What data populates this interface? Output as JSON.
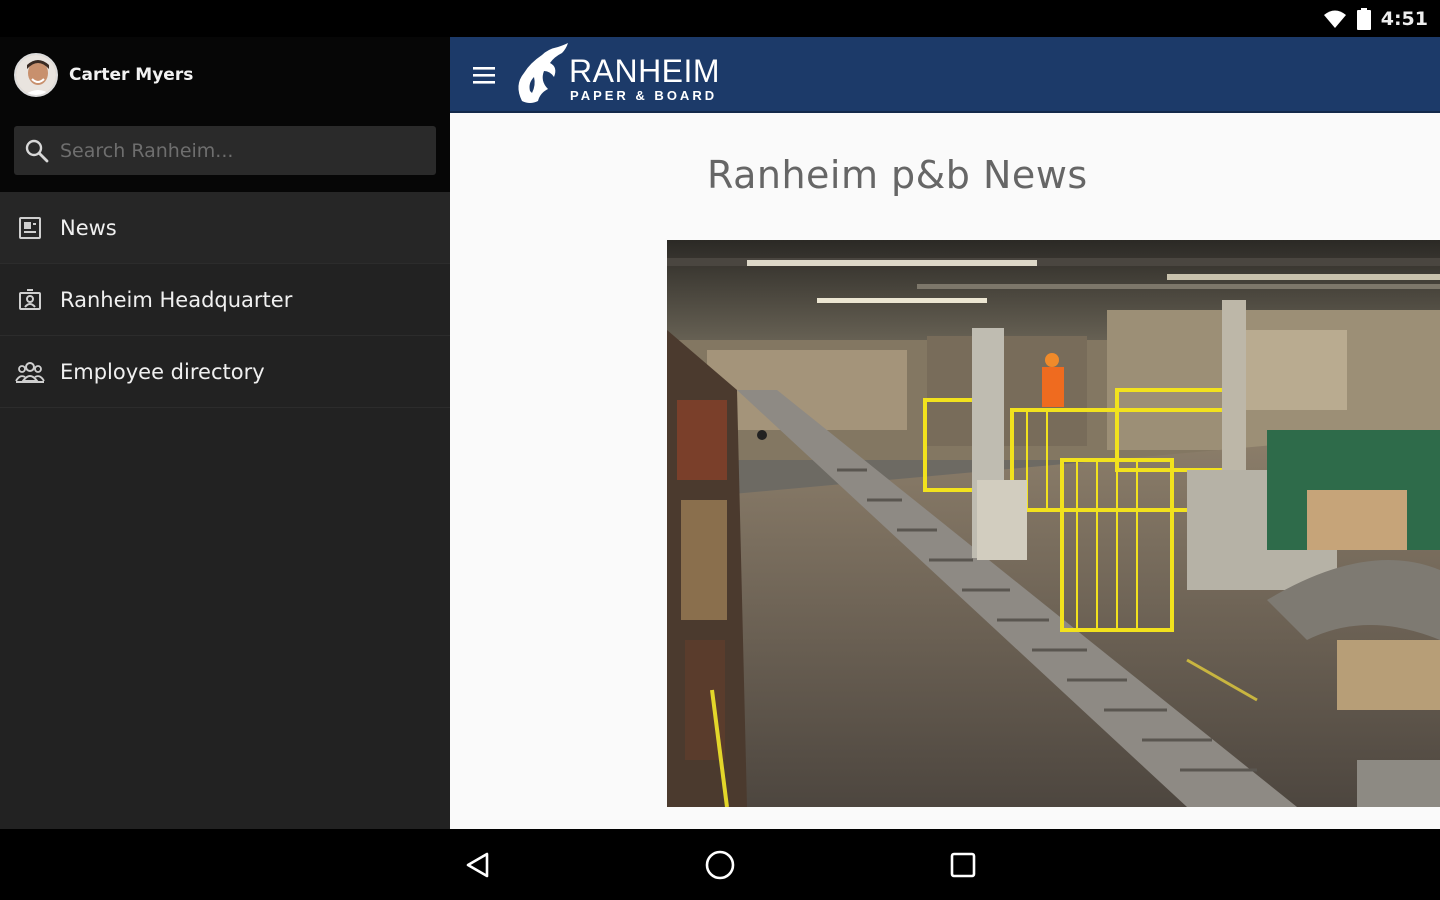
{
  "status_bar": {
    "time": "4:51",
    "icons": [
      "wifi-icon",
      "battery-icon"
    ]
  },
  "drawer": {
    "user": {
      "name": "Carter Myers",
      "avatar": "avatar"
    },
    "search": {
      "placeholder": "Search Ranheim...",
      "value": ""
    },
    "items": [
      {
        "label": "News",
        "icon": "news-icon",
        "active": true
      },
      {
        "label": "Ranheim Headquarter",
        "icon": "headquarter-icon",
        "active": false
      },
      {
        "label": "Employee directory",
        "icon": "people-icon",
        "active": false
      }
    ]
  },
  "app_bar": {
    "brand_color": "#1c3a69",
    "logo_name": "RANHEIM",
    "logo_sub": "PAPER & BOARD"
  },
  "main": {
    "title": "Ranheim p&b News",
    "hero_image": "factory-floor-photo"
  },
  "nav_bar": {
    "buttons": [
      "back-icon",
      "home-icon",
      "recents-icon"
    ]
  }
}
